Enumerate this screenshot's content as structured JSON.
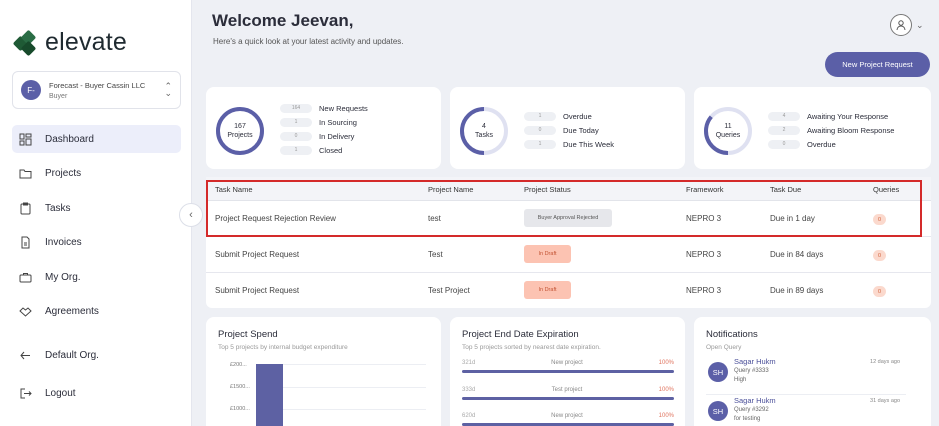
{
  "brand": {
    "name": "elevate"
  },
  "org": {
    "avatar": "F-",
    "name": "Forecast - Buyer Cassin LLC",
    "role": "Buyer"
  },
  "nav": [
    {
      "label": "Dashboard",
      "icon": "dashboard-icon",
      "active": true
    },
    {
      "label": "Projects",
      "icon": "folder-icon"
    },
    {
      "label": "Tasks",
      "icon": "clipboard-icon"
    },
    {
      "label": "Invoices",
      "icon": "invoice-icon"
    },
    {
      "label": "My Org.",
      "icon": "briefcase-icon"
    },
    {
      "label": "Agreements",
      "icon": "handshake-icon"
    }
  ],
  "nav_bottom": [
    {
      "label": "Default Org.",
      "icon": "switch-org-icon"
    },
    {
      "label": "Logout",
      "icon": "logout-icon"
    }
  ],
  "header": {
    "welcome": "Welcome Jeevan,",
    "subtitle": "Here's a quick look at your latest activity and updates.",
    "new_request": "New Project Request"
  },
  "stats": {
    "projects": {
      "count": "167",
      "label": "Projects",
      "rows": [
        {
          "value": "164",
          "label": "New Requests"
        },
        {
          "value": "1",
          "label": "In Sourcing"
        },
        {
          "value": "0",
          "label": "In Delivery"
        },
        {
          "value": "1",
          "label": "Closed"
        }
      ]
    },
    "tasks": {
      "count": "4",
      "label": "Tasks",
      "rows": [
        {
          "value": "1",
          "label": "Overdue"
        },
        {
          "value": "0",
          "label": "Due Today"
        },
        {
          "value": "1",
          "label": "Due This Week"
        }
      ]
    },
    "queries": {
      "count": "11",
      "label": "Queries",
      "rows": [
        {
          "value": "4",
          "label": "Awaiting Your Response"
        },
        {
          "value": "2",
          "label": "Awaiting Bloom Response"
        },
        {
          "value": "0",
          "label": "Overdue"
        }
      ]
    }
  },
  "task_table": {
    "headers": [
      "Task Name",
      "Project Name",
      "Project Status",
      "Framework",
      "Task Due",
      "Queries"
    ],
    "rows": [
      {
        "task": "Project Request Rejection Review",
        "project": "test",
        "status": "Buyer Approval Rejected",
        "status_kind": "grey",
        "framework": "NEPRO 3",
        "due": "Due in 1 day",
        "queries": "0"
      },
      {
        "task": "Submit Project Request",
        "project": "Test",
        "status": "In Draft",
        "status_kind": "orange",
        "framework": "NEPRO 3",
        "due": "Due in 84 days",
        "queries": "0"
      },
      {
        "task": "Submit Project Request",
        "project": "Test Project",
        "status": "In Draft",
        "status_kind": "orange",
        "framework": "NEPRO 3",
        "due": "Due in 89 days",
        "queries": "0"
      }
    ]
  },
  "project_spend": {
    "title": "Project Spend",
    "subtitle": "Top 5 projects by internal budget expenditure"
  },
  "chart_data": {
    "type": "bar",
    "title": "Project Spend",
    "subtitle": "Top 5 projects by internal budget expenditure",
    "y_ticks": [
      "£200...",
      "£1500...",
      "£1000..."
    ],
    "values": [
      2000
    ],
    "ylim": [
      0,
      2000
    ]
  },
  "expiration": {
    "title": "Project End Date Expiration",
    "subtitle": "Top 5 projects sorted by nearest date expiration.",
    "rows": [
      {
        "days": "321d",
        "name": "New project",
        "percent": "100%",
        "fill": 1.0
      },
      {
        "days": "333d",
        "name": "Test project",
        "percent": "100%",
        "fill": 1.0
      },
      {
        "days": "620d",
        "name": "New project",
        "percent": "100%",
        "fill": 1.0
      }
    ]
  },
  "notifications": {
    "title": "Notifications",
    "subtitle": "Open Query",
    "items": [
      {
        "initials": "SH",
        "name": "Sagar Hukm",
        "query": "Query #3333",
        "extra": "High",
        "time": "12 days ago"
      },
      {
        "initials": "SH",
        "name": "Sagar Hukm",
        "query": "Query #3292",
        "extra": "for testing",
        "time": "31 days ago"
      }
    ]
  }
}
